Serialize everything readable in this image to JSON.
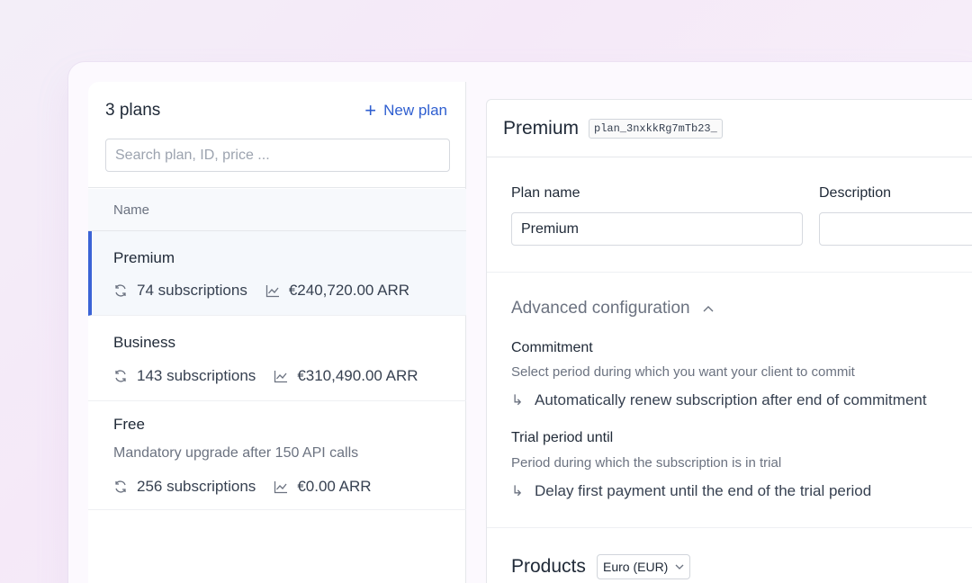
{
  "plans_panel": {
    "count_label": "3 plans",
    "new_plan_label": "New plan",
    "search_placeholder": "Search plan, ID, price ...",
    "column_name": "Name",
    "plans": [
      {
        "name": "Premium",
        "description": "",
        "subscriptions": "74 subscriptions",
        "arr": "€240,720.00 ARR",
        "selected": true
      },
      {
        "name": "Business",
        "description": "",
        "subscriptions": "143 subscriptions",
        "arr": "€310,490.00 ARR",
        "selected": false
      },
      {
        "name": "Free",
        "description": "Mandatory upgrade after 150 API calls",
        "subscriptions": "256 subscriptions",
        "arr": "€0.00 ARR",
        "selected": false
      }
    ]
  },
  "detail": {
    "title": "Premium",
    "plan_id": "plan_3nxkkRg7mTb23_",
    "plan_name_label": "Plan name",
    "plan_name_value": "Premium",
    "description_label": "Description",
    "description_value": "",
    "advanced_label": "Advanced configuration",
    "commitment": {
      "title": "Commitment",
      "help": "Select period during which you want your client to commit",
      "option": "Automatically renew subscription after end of commitment"
    },
    "trial": {
      "title": "Trial period until",
      "help": "Period during which the subscription is in trial",
      "option": "Delay first payment until the end of the trial period"
    },
    "products_label": "Products",
    "currency_value": "Euro (EUR)"
  },
  "colors": {
    "accent": "#3b63d6",
    "link": "#2f5fd0"
  },
  "icons": {
    "subscriptions": "refresh-icon",
    "arr": "trend-chart-icon",
    "advanced_toggle": "chevron-up-icon",
    "currency_toggle": "chevron-down-icon",
    "new_plan": "plus-icon",
    "option": "sub-arrow-icon"
  }
}
